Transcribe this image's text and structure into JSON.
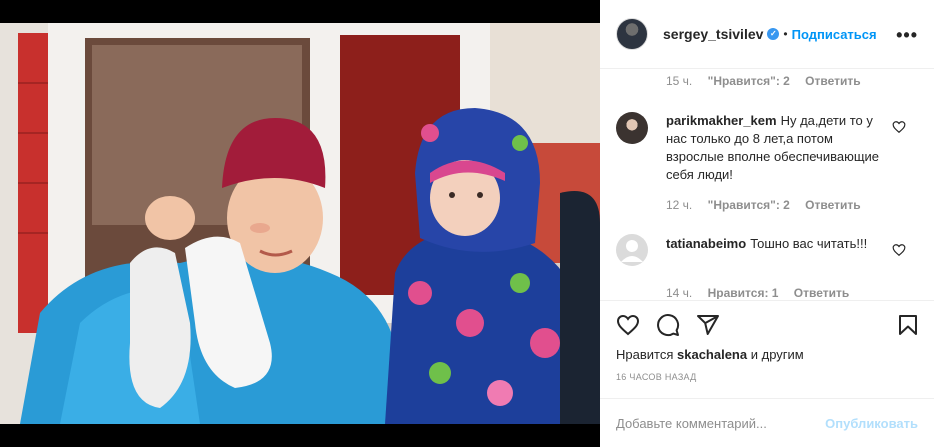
{
  "header": {
    "username": "sergey_tsivilev",
    "verified_badge": "✓",
    "separator": "•",
    "follow_label": "Подписаться",
    "more_label": "•••"
  },
  "comments": [
    {
      "meta": {
        "time": "15 ч.",
        "likes": "\"Нравится\": 2",
        "reply": "Ответить"
      }
    },
    {
      "user": "parikmakher_kem",
      "text": "Ну да,дети то у нас только до 8 лет,а потом взрослые вполне обеспечивающие себя люди!",
      "meta": {
        "time": "12 ч.",
        "likes": "\"Нравится\": 2",
        "reply": "Ответить"
      }
    },
    {
      "user": "tatianabeimo",
      "text": "Тошно вас читать!!!",
      "meta": {
        "time": "14 ч.",
        "likes": "Нравится: 1",
        "reply": "Ответить"
      }
    }
  ],
  "actions": {
    "likes_prefix": "Нравится",
    "likes_user": "skachalena",
    "likes_suffix": "и другим",
    "timestamp": "16 ЧАСОВ НАЗАД"
  },
  "add_comment": {
    "placeholder": "Добавьте комментарий...",
    "post_label": "Опубликовать"
  },
  "colors": {
    "accent": "#0095f6",
    "verified": "#3897f0",
    "muted": "#8e8e8e"
  },
  "icons": [
    "heart-icon",
    "comment-icon",
    "share-icon",
    "bookmark-icon",
    "more-icon",
    "verified-icon"
  ]
}
